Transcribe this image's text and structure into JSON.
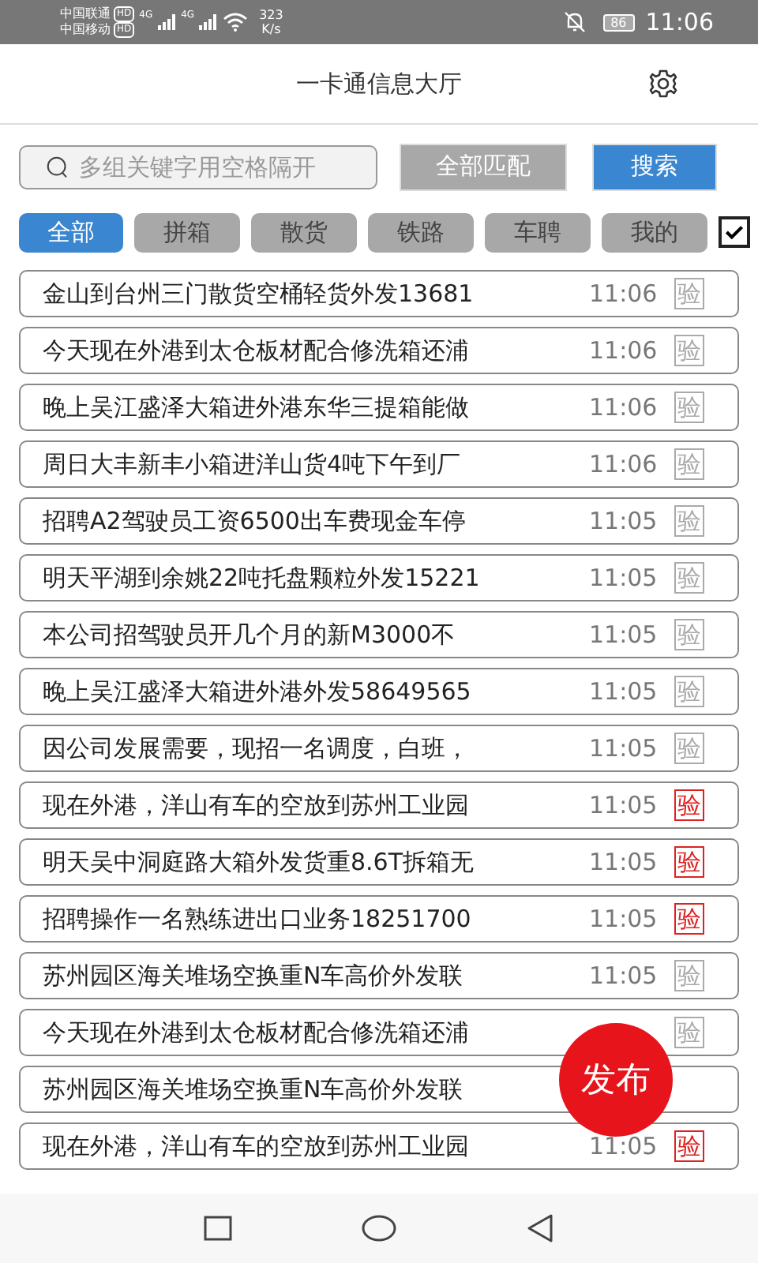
{
  "status_bar": {
    "carrier_1": "中国联通",
    "carrier_2": "中国移动",
    "hd_1": "HD",
    "hd_2": "HD",
    "net_1": "4G",
    "net_2": "4G",
    "speed": "323",
    "speed_unit": "K/s",
    "battery": "86",
    "time": "11:06"
  },
  "header": {
    "title": "一卡通信息大厅"
  },
  "search": {
    "placeholder": "多组关键字用空格隔开",
    "match_button": "全部匹配",
    "search_button": "搜索"
  },
  "tabs": [
    {
      "label": "全部",
      "selected": true
    },
    {
      "label": "拼箱",
      "selected": false
    },
    {
      "label": "散货",
      "selected": false
    },
    {
      "label": "铁路",
      "selected": false
    },
    {
      "label": "车聘",
      "selected": false
    },
    {
      "label": "我的",
      "selected": false
    }
  ],
  "filter_checkbox": {
    "checked": true
  },
  "posts": [
    {
      "text": "金山到台州三门散货空桶轻货外发13681",
      "time": "11:06",
      "badge": "验",
      "verified": false
    },
    {
      "text": "今天现在外港到太仓板材配合修洗箱还浦",
      "time": "11:06",
      "badge": "验",
      "verified": false
    },
    {
      "text": "晚上吴江盛泽大箱进外港东华三提箱能做",
      "time": "11:06",
      "badge": "验",
      "verified": false
    },
    {
      "text": "周日大丰新丰小箱进洋山货4吨下午到厂",
      "time": "11:06",
      "badge": "验",
      "verified": false
    },
    {
      "text": "招聘A2驾驶员工资6500出车费现金车停",
      "time": "11:05",
      "badge": "验",
      "verified": false
    },
    {
      "text": "明天平湖到余姚22吨托盘颗粒外发15221",
      "time": "11:05",
      "badge": "验",
      "verified": false
    },
    {
      "text": "本公司招驾驶员开几个月的新M3000不",
      "time": "11:05",
      "badge": "验",
      "verified": false
    },
    {
      "text": "晚上吴江盛泽大箱进外港外发58649565",
      "time": "11:05",
      "badge": "验",
      "verified": false
    },
    {
      "text": "因公司发展需要，现招一名调度，白班，",
      "time": "11:05",
      "badge": "验",
      "verified": false
    },
    {
      "text": "现在外港，洋山有车的空放到苏州工业园",
      "time": "11:05",
      "badge": "验",
      "verified": true
    },
    {
      "text": "明天吴中洞庭路大箱外发货重8.6T拆箱无",
      "time": "11:05",
      "badge": "验",
      "verified": true
    },
    {
      "text": "招聘操作一名熟练进出口业务18251700",
      "time": "11:05",
      "badge": "验",
      "verified": true
    },
    {
      "text": "苏州园区海关堆场空换重N车高价外发联",
      "time": "11:05",
      "badge": "验",
      "verified": false
    },
    {
      "text": "今天现在外港到太仓板材配合修洗箱还浦",
      "badge": "验",
      "verified": false
    },
    {
      "text": "苏州园区海关堆场空换重N车高价外发联"
    },
    {
      "text": "现在外港，洋山有车的空放到苏州工业园",
      "time": "11:05",
      "badge": "验",
      "verified": true
    }
  ],
  "publish_button": "发布"
}
